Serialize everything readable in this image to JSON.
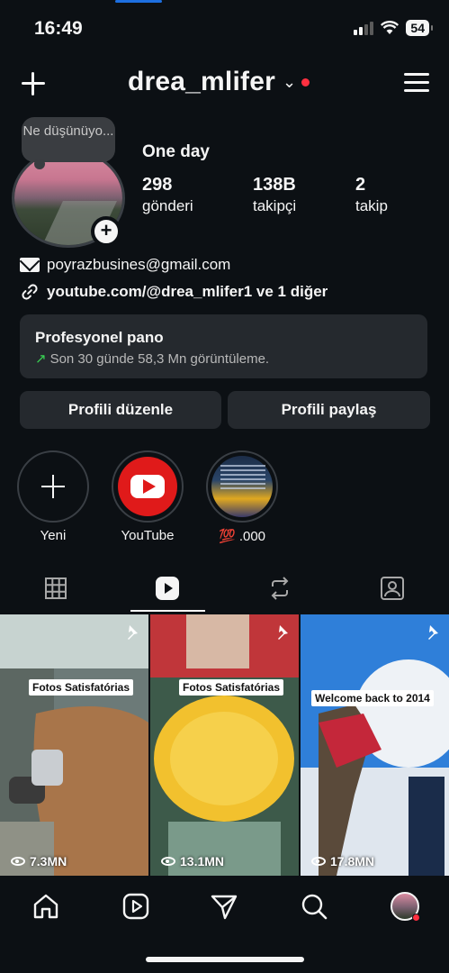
{
  "status_bar": {
    "time": "16:49",
    "battery": "54"
  },
  "header": {
    "username": "drea_mlifer",
    "chevron": "⌄"
  },
  "profile": {
    "note": "Ne düşünüyo...",
    "display_name": "One day",
    "stats": [
      {
        "value": "298",
        "label": "gönderi"
      },
      {
        "value": "138B",
        "label": "takipçi"
      },
      {
        "value": "2",
        "label": "takip"
      }
    ],
    "email": "poyrazbusines@gmail.com",
    "link": "youtube.com/@drea_mlifer1 ve 1 diğer"
  },
  "pro_dashboard": {
    "title": "Profesyonel pano",
    "subtitle": "Son 30 günde 58,3 Mn görüntüleme."
  },
  "buttons": {
    "edit": "Profili düzenle",
    "share": "Profili paylaş"
  },
  "highlights": [
    {
      "label": "Yeni"
    },
    {
      "label": "YouTube"
    },
    {
      "label": "💯 .000"
    }
  ],
  "grid": [
    {
      "caption": "Fotos Satisfatórias",
      "views": "7.3MN"
    },
    {
      "caption": "Fotos Satisfatórias",
      "views": "13.1MN"
    },
    {
      "caption": "Welcome back to 2014",
      "views": "17.8MN"
    }
  ],
  "colors": {
    "accent_red": "#ff3040",
    "panel": "#25292e",
    "background": "#0c1014",
    "green_arrow": "#39d353"
  }
}
